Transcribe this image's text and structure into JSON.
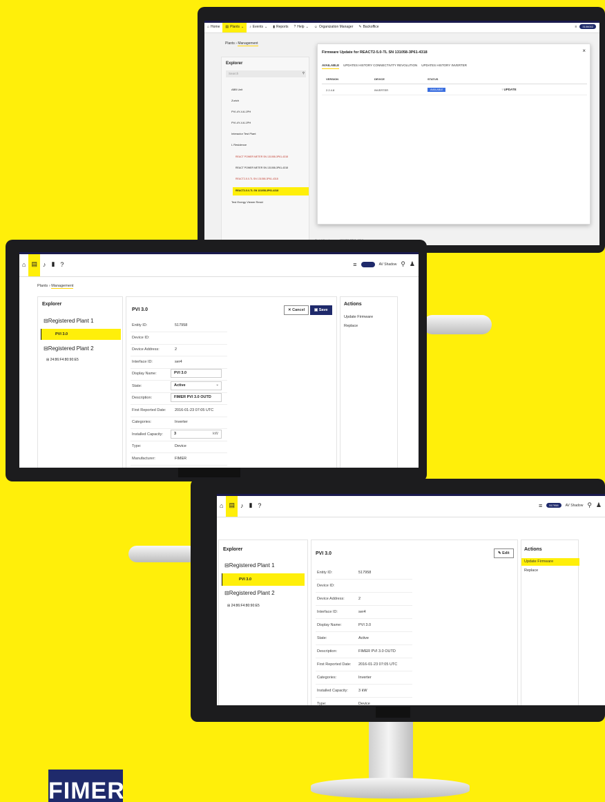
{
  "monitor_back": {
    "nav": {
      "items": [
        "Home",
        "Plants",
        "Events",
        "Reports",
        "Help",
        "Organization Manager",
        "Backoffice"
      ],
      "pill": "3106002"
    },
    "breadcrumb": [
      "Plants",
      "Management"
    ],
    "explorer": {
      "title": "Explorer",
      "search_placeholder": "Search",
      "items": [
        "ABB Unit",
        "Zurich",
        "PVI-4Y-4.6-1PH",
        "PVI-4Y-4.6-1PH",
        "Interactor Test Plant",
        "L Residence",
        "REACT POWER METER SN 131058-3P61-4318",
        "REACT POWER METER SN 131058-3P61-4318",
        "REACT2-5.0-TL SN 131058-3P61-4318",
        "REACT2-5.0-TL SN 131058-3P61-4318",
        "Test Energy Viewer Resid"
      ]
    },
    "serial": {
      "label": "Serial Number:",
      "value": "131058-3P61-4318"
    },
    "modal": {
      "title": "Firmware Update for REACT2-5.0-TL SN 131058-3P61-4318",
      "close": "×",
      "tabs": [
        "AVAILABLE",
        "UPDATES HISTORY CONNECTIVITY REVOLUTION",
        "UPDATES HISTORY INVERTER"
      ],
      "columns": [
        "VERSION",
        "DEVICE",
        "STATUS"
      ],
      "row": {
        "version": "2.2.4.8",
        "device": "INVERTER",
        "status": "AVAILABLE",
        "action": "UPDATE"
      }
    }
  },
  "monitor_left": {
    "nav": {
      "toggle_label": "AV Shadow"
    },
    "breadcrumb": [
      "Plants",
      "Management"
    ],
    "explorer": {
      "title": "Explorer",
      "plant1": "Registered Plant 1",
      "device1": "PVI 3.0",
      "plant2": "Registered Plant 2",
      "device2": "24:86:F4:80:90:E5"
    },
    "detail": {
      "title": "PVI 3.0",
      "cancel_label": "Cancel",
      "save_label": "Save",
      "fields": [
        {
          "label": "Entity ID:",
          "value": "517958"
        },
        {
          "label": "Device ID:",
          "value": ""
        },
        {
          "label": "Device Address:",
          "value": "2"
        },
        {
          "label": "Interface ID:",
          "value": "ser4"
        },
        {
          "label": "Display Name:",
          "value": "PVI 3.0"
        },
        {
          "label": "State:",
          "value": "Active"
        },
        {
          "label": "Description:",
          "value": "FIMER PVI 3.0 OUTD"
        },
        {
          "label": "First Reported Date:",
          "value": "2016-01-23 07:05 UTC"
        },
        {
          "label": "Categories:",
          "value": "Inverter"
        },
        {
          "label": "Installed Capacity:",
          "value": "3"
        },
        {
          "label": "Type:",
          "value": "Device"
        },
        {
          "label": "Manufacturer:",
          "value": "FIMER"
        }
      ],
      "capacity_unit": "kW"
    },
    "actions": {
      "title": "Actions",
      "items": [
        "Update Firmware",
        "Replace"
      ]
    }
  },
  "monitor_right": {
    "nav": {
      "pill": "517958",
      "toggle_label": "AV Shadow"
    },
    "explorer": {
      "title": "Explorer",
      "plant1": "Registered Plant 1",
      "device1": "PVI 3.0",
      "plant2": "Registered Plant 2",
      "device2": "24:86:F4:80:90:E5"
    },
    "detail": {
      "title": "PVI 3.0",
      "edit_label": "Edit",
      "fields": [
        {
          "label": "Entity ID:",
          "value": "517958"
        },
        {
          "label": "Device ID:",
          "value": ""
        },
        {
          "label": "Device Address:",
          "value": "2"
        },
        {
          "label": "Interface ID:",
          "value": "ser4"
        },
        {
          "label": "Display Name:",
          "value": "PVI 3.0"
        },
        {
          "label": "State:",
          "value": "Active"
        },
        {
          "label": "Description:",
          "value": "FIMER PVI 3.0 OUTD"
        },
        {
          "label": "First Reported Date:",
          "value": "2016-01-23 07:05 UTC"
        },
        {
          "label": "Categories:",
          "value": "Inverter"
        },
        {
          "label": "Installed Capacity:",
          "value": "3 kW"
        },
        {
          "label": "Type:",
          "value": "Device"
        }
      ]
    },
    "actions": {
      "title": "Actions",
      "items": [
        "Update Firmware",
        "Replace"
      ]
    }
  },
  "logo": "FIMER",
  "colors": {
    "brand_yellow": "#ffef0a",
    "brand_navy": "#1f2a6b",
    "status_blue": "#3b6fe0"
  }
}
